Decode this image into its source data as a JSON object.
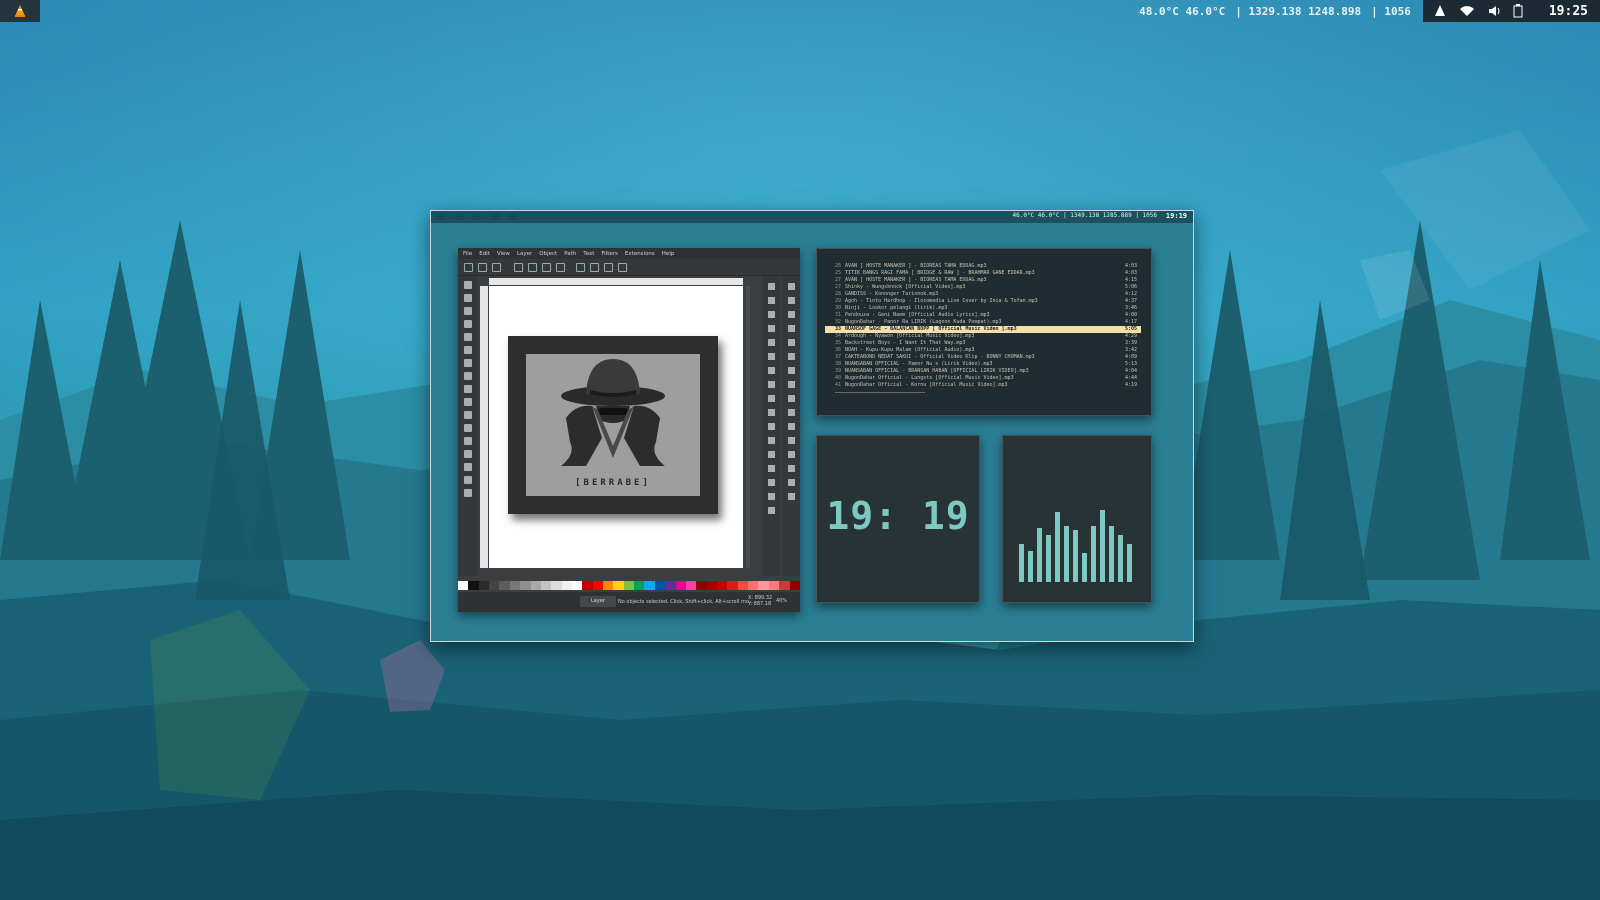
{
  "top_bar": {
    "launcher_icon": "vlc-cone-icon",
    "temperatures": "48.0°C 46.0°C",
    "numbers_a": "| 1329.138 1248.898",
    "numbers_b": "| 1056",
    "tray_icons": [
      "user-cone-icon",
      "wifi-icon",
      "volume-icon",
      "battery-icon"
    ],
    "clock": "19:25"
  },
  "preview": {
    "mini_stats": "46.0°C 46.0°C | 1349.138 1285.889 | 1056",
    "mini_clock": "19:19"
  },
  "inkscape": {
    "menu": [
      "File",
      "Edit",
      "View",
      "Layer",
      "Object",
      "Path",
      "Text",
      "Filters",
      "Extensions",
      "Help"
    ],
    "artwork_text": "[BERRABE]",
    "layer_label": "Layer",
    "status_msg": "No objects selected. Click, Shift+click, Alt+scroll mo...",
    "coords": "X: 899.32\nY: 887.18",
    "zoom": "40%",
    "palette": [
      "#ffffff",
      "#111111",
      "#2a2a2a",
      "#444",
      "#5c5c5c",
      "#777",
      "#909090",
      "#a9a9a9",
      "#c4c4c4",
      "#dedede",
      "#f2f2f2",
      "#ffffff",
      "#c00000",
      "#ff0000",
      "#ff8800",
      "#ffd400",
      "#7cc242",
      "#00a651",
      "#00aeef",
      "#0054a6",
      "#662d91",
      "#ec008c",
      "#ff3fa0",
      "#8b0000",
      "#a50000",
      "#cc0000",
      "#e31a1c",
      "#ff4444",
      "#ff6f6f",
      "#ff9999",
      "#f08080",
      "#c04040",
      "#900000"
    ]
  },
  "playlist": {
    "rows": [
      {
        "n": "26",
        "t": "AVAN [ HOSTE MANAKER ] - BIOREAS TAMA EDDAG.mp3",
        "d": "4:03"
      },
      {
        "n": "25",
        "t": "TITIK BANGS RAGI FAMA [ BRIDGE & RAW ] - BRAHMAR GANE EDDAR.mp3",
        "d": "4:03"
      },
      {
        "n": "27",
        "t": "AVAN [ HOSTE MANAKER ] - BIOREAS TAMA EDDAG.mp3",
        "d": "4:15"
      },
      {
        "n": "27",
        "t": "Shinky - Wungsknock [Official Video].mp3",
        "d": "5:06"
      },
      {
        "n": "28",
        "t": "GANDISS - Konnnger Tarinnok.mp3",
        "d": "4:12"
      },
      {
        "n": "29",
        "t": "Agoh - Tinto Hardhop - Ilosomedia Live Cover by Inia & Tofan.mp3",
        "d": "4:37"
      },
      {
        "n": "30",
        "t": "Ninji - Lookor pelangi (lirik).mp3",
        "d": "3:46"
      },
      {
        "n": "31",
        "t": "Pendouza - Geni Naem [Official Audio Lyrics].mp3",
        "d": "4:00"
      },
      {
        "n": "32",
        "t": "NugonDahar - Panor Ra LIRIK (Lagoon Kuda Pompat).mp3",
        "d": "4:17"
      },
      {
        "n": "33",
        "t": "NUANSOF GAGE - BALANCAN BOPP [ Official Music Video ].mp3",
        "d": "5:05",
        "sel": true
      },
      {
        "n": "34",
        "t": "Ardough - Nyawon [Official Music Video].mp3",
        "d": "4:29"
      },
      {
        "n": "35",
        "t": "Backstreet Boys - I Want It That Way.mp3",
        "d": "3:39"
      },
      {
        "n": "36",
        "t": "NOAH - Kupu-Kupu Malam (Official Audio).mp3",
        "d": "3:42"
      },
      {
        "n": "37",
        "t": "CAKTEABOND NEDAT SAKUI - Official Video Klip - BONNY CHOMAN.mp3",
        "d": "4:09"
      },
      {
        "n": "38",
        "t": "NUANSABAN OFFICIAL - Pamor Nu_s (Lirik Video).mp3",
        "d": "5:13"
      },
      {
        "n": "39",
        "t": "NUANSABAN OFFICIAL - BRANSAN HABAN [OFFICIAL LIRIK VIDEO].mp3",
        "d": "4:04"
      },
      {
        "n": "40",
        "t": "NugonDahar Official - Lungsts [Official Music Video].mp3",
        "d": "4:44"
      },
      {
        "n": "41",
        "t": "NugonDahar Official - Kornu [Official Music Video].mp3",
        "d": "4:19"
      }
    ]
  },
  "clock_widget": {
    "time": "19: 19"
  },
  "visualizer": {
    "levels": [
      0.42,
      0.35,
      0.6,
      0.52,
      0.78,
      0.62,
      0.58,
      0.32,
      0.62,
      0.8,
      0.62,
      0.52,
      0.42
    ]
  }
}
